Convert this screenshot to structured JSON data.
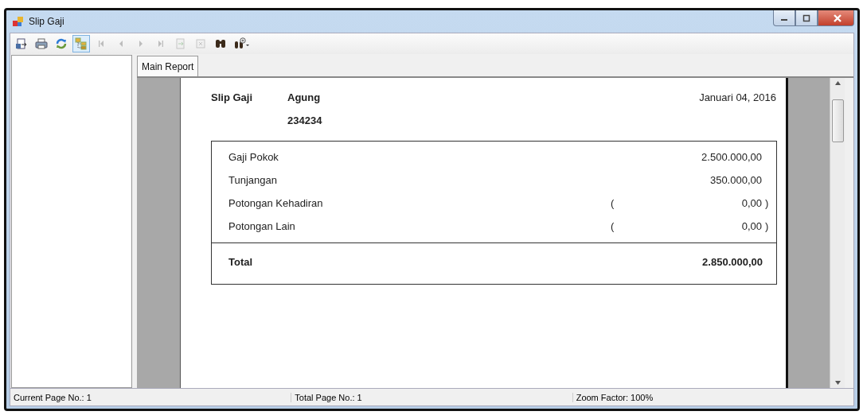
{
  "window": {
    "title": "Slip Gaji"
  },
  "toolbar": [
    {
      "kind": "export",
      "disabled": false,
      "on": false
    },
    {
      "kind": "print",
      "disabled": false,
      "on": false
    },
    {
      "kind": "refresh",
      "disabled": false,
      "on": false
    },
    {
      "kind": "tree",
      "disabled": false,
      "on": true
    },
    {
      "kind": "first",
      "disabled": true,
      "on": false
    },
    {
      "kind": "prev",
      "disabled": true,
      "on": false
    },
    {
      "kind": "next",
      "disabled": true,
      "on": false
    },
    {
      "kind": "last",
      "disabled": true,
      "on": false
    },
    {
      "kind": "goto",
      "disabled": true,
      "on": false
    },
    {
      "kind": "stop",
      "disabled": true,
      "on": false
    },
    {
      "kind": "search",
      "disabled": false,
      "on": false
    },
    {
      "kind": "zoom",
      "disabled": false,
      "on": false
    }
  ],
  "tabs": [
    {
      "label": "Main Report",
      "selected": true
    }
  ],
  "report": {
    "title": "Slip Gaji",
    "name": "Agung",
    "id": "234234",
    "date": "Januari 04, 2016",
    "rows": [
      {
        "label": "Gaji Pokok",
        "value": "2.500.000,00"
      },
      {
        "label": "Tunjangan",
        "value": "350.000,00"
      },
      {
        "label": "Potongan Kehadiran",
        "open": "(",
        "value": "0,00",
        "close": ")"
      },
      {
        "label": "Potongan Lain",
        "open": "(",
        "value": "0,00",
        "close": ")"
      }
    ],
    "total": {
      "label": "Total",
      "value": "2.850.000,00"
    }
  },
  "status_bar": [
    "Current Page No.: 1",
    "Total Page No.: 1",
    "Zoom Factor: 100%"
  ]
}
